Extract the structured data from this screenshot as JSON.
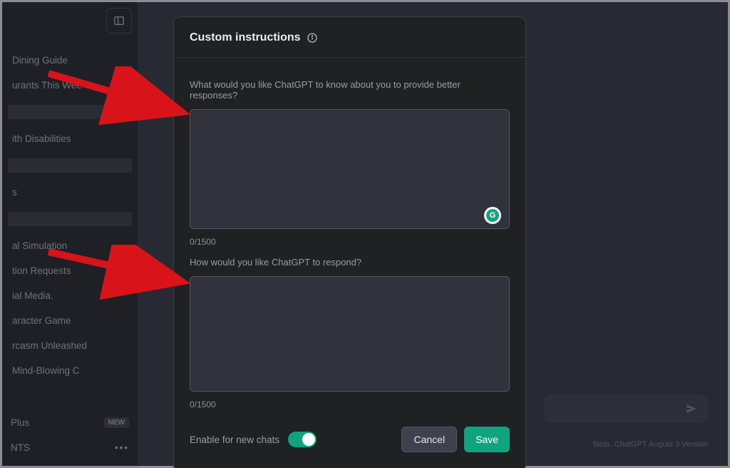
{
  "sidebar": {
    "items": [
      "Dining Guide",
      "urants This Wee",
      "",
      "ith Disabilities",
      "",
      "s",
      "",
      "al Simulation",
      "tion Requests",
      "ial Media.",
      "aracter Game",
      "rcasm Unleashed",
      "Mind-Blowing C"
    ],
    "bottom": {
      "plus_label": "Plus",
      "plus_badge": "NEW",
      "user_label": "NTS"
    }
  },
  "main": {
    "footer_text": "facts. ChatGPT August 3 Version"
  },
  "modal": {
    "title": "Custom instructions",
    "field1_label": "What would you like ChatGPT to know about you to provide better responses?",
    "field1_value": "",
    "field1_counter": "0/1500",
    "field2_label": "How would you like ChatGPT to respond?",
    "field2_value": "",
    "field2_counter": "0/1500",
    "toggle_label": "Enable for new chats",
    "toggle_on": true,
    "cancel_label": "Cancel",
    "save_label": "Save"
  },
  "icons": {
    "info": "info-icon",
    "grammarly": "grammarly-icon",
    "sidebar_toggle": "sidebar-toggle-icon",
    "send": "send-icon"
  }
}
